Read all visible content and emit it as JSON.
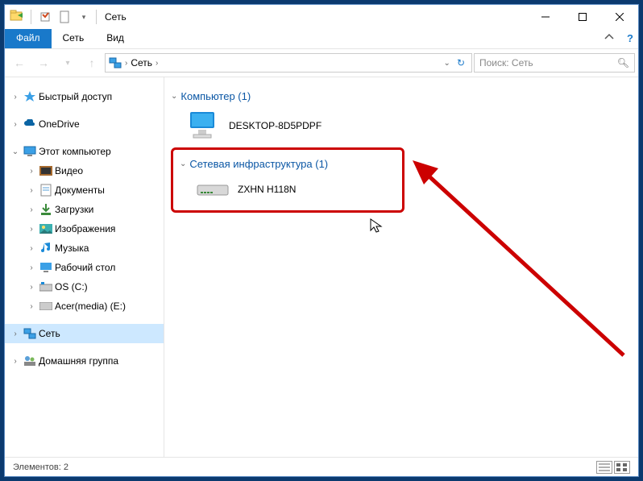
{
  "title": "Сеть",
  "menu": {
    "file": "Файл",
    "network": "Сеть",
    "view": "Вид"
  },
  "breadcrumb": "Сеть",
  "search_placeholder": "Поиск: Сеть",
  "sidebar": {
    "quick": "Быстрый доступ",
    "onedrive": "OneDrive",
    "thispc": "Этот компьютер",
    "video": "Видео",
    "docs": "Документы",
    "downloads": "Загрузки",
    "pictures": "Изображения",
    "music": "Музыка",
    "desktop": "Рабочий стол",
    "osc": "OS (C:)",
    "acer": "Acer(media) (E:)",
    "network": "Сеть",
    "homegroup": "Домашняя группа"
  },
  "groups": {
    "computer": {
      "title": "Компьютер (1)",
      "item": "DESKTOP-8D5PDPF"
    },
    "infra": {
      "title": "Сетевая инфраструктура (1)",
      "item": "ZXHN H118N"
    }
  },
  "status": "Элементов: 2"
}
